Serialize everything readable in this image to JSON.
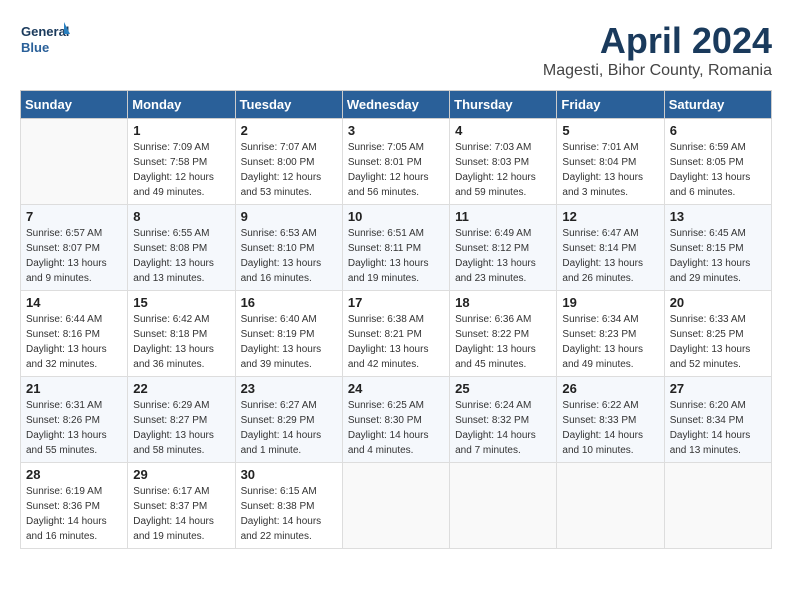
{
  "logo": {
    "line1": "General",
    "line2": "Blue"
  },
  "title": "April 2024",
  "subtitle": "Magesti, Bihor County, Romania",
  "days_header": [
    "Sunday",
    "Monday",
    "Tuesday",
    "Wednesday",
    "Thursday",
    "Friday",
    "Saturday"
  ],
  "weeks": [
    [
      {
        "num": "",
        "sunrise": "",
        "sunset": "",
        "daylight": ""
      },
      {
        "num": "1",
        "sunrise": "Sunrise: 7:09 AM",
        "sunset": "Sunset: 7:58 PM",
        "daylight": "Daylight: 12 hours and 49 minutes."
      },
      {
        "num": "2",
        "sunrise": "Sunrise: 7:07 AM",
        "sunset": "Sunset: 8:00 PM",
        "daylight": "Daylight: 12 hours and 53 minutes."
      },
      {
        "num": "3",
        "sunrise": "Sunrise: 7:05 AM",
        "sunset": "Sunset: 8:01 PM",
        "daylight": "Daylight: 12 hours and 56 minutes."
      },
      {
        "num": "4",
        "sunrise": "Sunrise: 7:03 AM",
        "sunset": "Sunset: 8:03 PM",
        "daylight": "Daylight: 12 hours and 59 minutes."
      },
      {
        "num": "5",
        "sunrise": "Sunrise: 7:01 AM",
        "sunset": "Sunset: 8:04 PM",
        "daylight": "Daylight: 13 hours and 3 minutes."
      },
      {
        "num": "6",
        "sunrise": "Sunrise: 6:59 AM",
        "sunset": "Sunset: 8:05 PM",
        "daylight": "Daylight: 13 hours and 6 minutes."
      }
    ],
    [
      {
        "num": "7",
        "sunrise": "Sunrise: 6:57 AM",
        "sunset": "Sunset: 8:07 PM",
        "daylight": "Daylight: 13 hours and 9 minutes."
      },
      {
        "num": "8",
        "sunrise": "Sunrise: 6:55 AM",
        "sunset": "Sunset: 8:08 PM",
        "daylight": "Daylight: 13 hours and 13 minutes."
      },
      {
        "num": "9",
        "sunrise": "Sunrise: 6:53 AM",
        "sunset": "Sunset: 8:10 PM",
        "daylight": "Daylight: 13 hours and 16 minutes."
      },
      {
        "num": "10",
        "sunrise": "Sunrise: 6:51 AM",
        "sunset": "Sunset: 8:11 PM",
        "daylight": "Daylight: 13 hours and 19 minutes."
      },
      {
        "num": "11",
        "sunrise": "Sunrise: 6:49 AM",
        "sunset": "Sunset: 8:12 PM",
        "daylight": "Daylight: 13 hours and 23 minutes."
      },
      {
        "num": "12",
        "sunrise": "Sunrise: 6:47 AM",
        "sunset": "Sunset: 8:14 PM",
        "daylight": "Daylight: 13 hours and 26 minutes."
      },
      {
        "num": "13",
        "sunrise": "Sunrise: 6:45 AM",
        "sunset": "Sunset: 8:15 PM",
        "daylight": "Daylight: 13 hours and 29 minutes."
      }
    ],
    [
      {
        "num": "14",
        "sunrise": "Sunrise: 6:44 AM",
        "sunset": "Sunset: 8:16 PM",
        "daylight": "Daylight: 13 hours and 32 minutes."
      },
      {
        "num": "15",
        "sunrise": "Sunrise: 6:42 AM",
        "sunset": "Sunset: 8:18 PM",
        "daylight": "Daylight: 13 hours and 36 minutes."
      },
      {
        "num": "16",
        "sunrise": "Sunrise: 6:40 AM",
        "sunset": "Sunset: 8:19 PM",
        "daylight": "Daylight: 13 hours and 39 minutes."
      },
      {
        "num": "17",
        "sunrise": "Sunrise: 6:38 AM",
        "sunset": "Sunset: 8:21 PM",
        "daylight": "Daylight: 13 hours and 42 minutes."
      },
      {
        "num": "18",
        "sunrise": "Sunrise: 6:36 AM",
        "sunset": "Sunset: 8:22 PM",
        "daylight": "Daylight: 13 hours and 45 minutes."
      },
      {
        "num": "19",
        "sunrise": "Sunrise: 6:34 AM",
        "sunset": "Sunset: 8:23 PM",
        "daylight": "Daylight: 13 hours and 49 minutes."
      },
      {
        "num": "20",
        "sunrise": "Sunrise: 6:33 AM",
        "sunset": "Sunset: 8:25 PM",
        "daylight": "Daylight: 13 hours and 52 minutes."
      }
    ],
    [
      {
        "num": "21",
        "sunrise": "Sunrise: 6:31 AM",
        "sunset": "Sunset: 8:26 PM",
        "daylight": "Daylight: 13 hours and 55 minutes."
      },
      {
        "num": "22",
        "sunrise": "Sunrise: 6:29 AM",
        "sunset": "Sunset: 8:27 PM",
        "daylight": "Daylight: 13 hours and 58 minutes."
      },
      {
        "num": "23",
        "sunrise": "Sunrise: 6:27 AM",
        "sunset": "Sunset: 8:29 PM",
        "daylight": "Daylight: 14 hours and 1 minute."
      },
      {
        "num": "24",
        "sunrise": "Sunrise: 6:25 AM",
        "sunset": "Sunset: 8:30 PM",
        "daylight": "Daylight: 14 hours and 4 minutes."
      },
      {
        "num": "25",
        "sunrise": "Sunrise: 6:24 AM",
        "sunset": "Sunset: 8:32 PM",
        "daylight": "Daylight: 14 hours and 7 minutes."
      },
      {
        "num": "26",
        "sunrise": "Sunrise: 6:22 AM",
        "sunset": "Sunset: 8:33 PM",
        "daylight": "Daylight: 14 hours and 10 minutes."
      },
      {
        "num": "27",
        "sunrise": "Sunrise: 6:20 AM",
        "sunset": "Sunset: 8:34 PM",
        "daylight": "Daylight: 14 hours and 13 minutes."
      }
    ],
    [
      {
        "num": "28",
        "sunrise": "Sunrise: 6:19 AM",
        "sunset": "Sunset: 8:36 PM",
        "daylight": "Daylight: 14 hours and 16 minutes."
      },
      {
        "num": "29",
        "sunrise": "Sunrise: 6:17 AM",
        "sunset": "Sunset: 8:37 PM",
        "daylight": "Daylight: 14 hours and 19 minutes."
      },
      {
        "num": "30",
        "sunrise": "Sunrise: 6:15 AM",
        "sunset": "Sunset: 8:38 PM",
        "daylight": "Daylight: 14 hours and 22 minutes."
      },
      {
        "num": "",
        "sunrise": "",
        "sunset": "",
        "daylight": ""
      },
      {
        "num": "",
        "sunrise": "",
        "sunset": "",
        "daylight": ""
      },
      {
        "num": "",
        "sunrise": "",
        "sunset": "",
        "daylight": ""
      },
      {
        "num": "",
        "sunrise": "",
        "sunset": "",
        "daylight": ""
      }
    ]
  ]
}
